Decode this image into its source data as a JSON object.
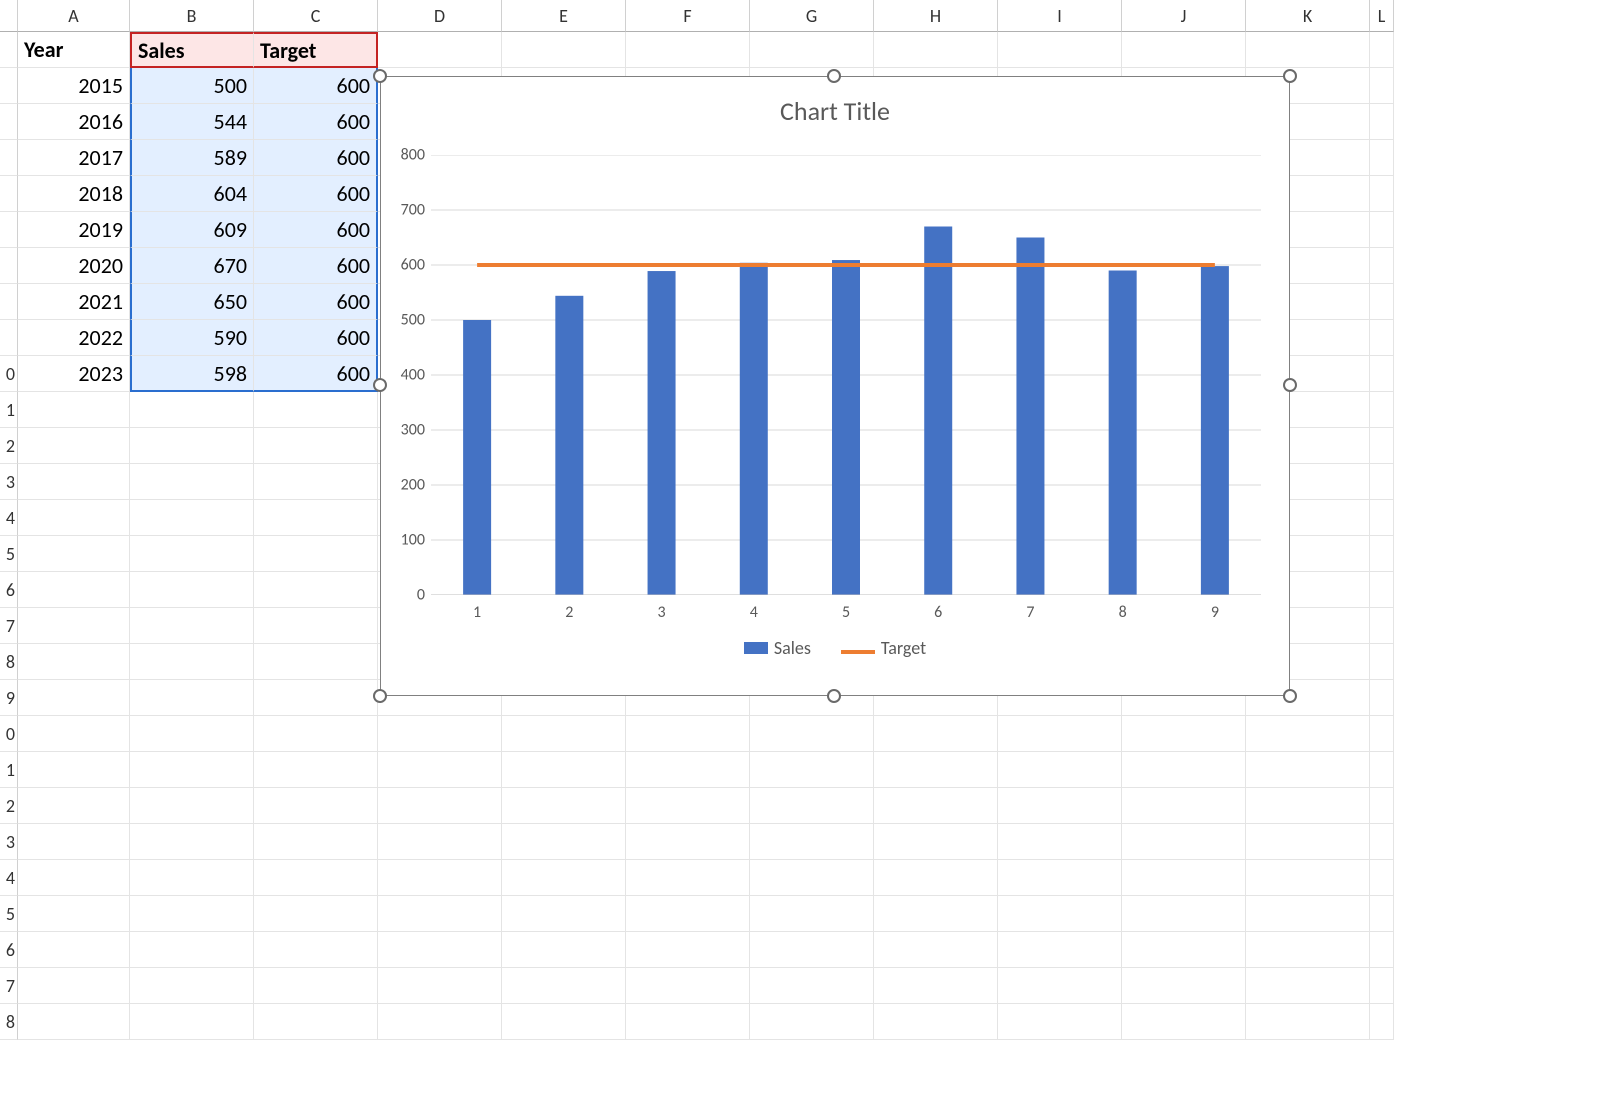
{
  "columns": [
    "A",
    "B",
    "C",
    "D",
    "E",
    "F",
    "G",
    "H",
    "I",
    "J",
    "K",
    "L"
  ],
  "row_headers": [
    "",
    "",
    "",
    "",
    "",
    "",
    "",
    "",
    "",
    "0",
    "1",
    "2",
    "3",
    "4",
    "5",
    "6",
    "7",
    "8",
    "9",
    "0",
    "1",
    "2",
    "3",
    "4",
    "5",
    "6",
    "7",
    "8"
  ],
  "table": {
    "headers": {
      "A": "Year",
      "B": "Sales",
      "C": "Target"
    },
    "rows": [
      {
        "year": "2015",
        "sales": "500",
        "target": "600"
      },
      {
        "year": "2016",
        "sales": "544",
        "target": "600"
      },
      {
        "year": "2017",
        "sales": "589",
        "target": "600"
      },
      {
        "year": "2018",
        "sales": "604",
        "target": "600"
      },
      {
        "year": "2019",
        "sales": "609",
        "target": "600"
      },
      {
        "year": "2020",
        "sales": "670",
        "target": "600"
      },
      {
        "year": "2021",
        "sales": "650",
        "target": "600"
      },
      {
        "year": "2022",
        "sales": "590",
        "target": "600"
      },
      {
        "year": "2023",
        "sales": "598",
        "target": "600"
      }
    ]
  },
  "chart": {
    "title": "Chart Title",
    "legend": {
      "sales": "Sales",
      "target": "Target"
    },
    "yticks": [
      "0",
      "100",
      "200",
      "300",
      "400",
      "500",
      "600",
      "700",
      "800"
    ],
    "xticks": [
      "1",
      "2",
      "3",
      "4",
      "5",
      "6",
      "7",
      "8",
      "9"
    ]
  },
  "chart_data": {
    "type": "bar",
    "title": "Chart Title",
    "categories": [
      "1",
      "2",
      "3",
      "4",
      "5",
      "6",
      "7",
      "8",
      "9"
    ],
    "series": [
      {
        "name": "Sales",
        "type": "bar",
        "values": [
          500,
          544,
          589,
          604,
          609,
          670,
          650,
          590,
          598
        ],
        "color": "#4472c4"
      },
      {
        "name": "Target",
        "type": "line",
        "values": [
          600,
          600,
          600,
          600,
          600,
          600,
          600,
          600,
          600
        ],
        "color": "#ed7d31"
      }
    ],
    "xlabel": "",
    "ylabel": "",
    "ylim": [
      0,
      800
    ],
    "grid": true,
    "legend_position": "bottom"
  }
}
